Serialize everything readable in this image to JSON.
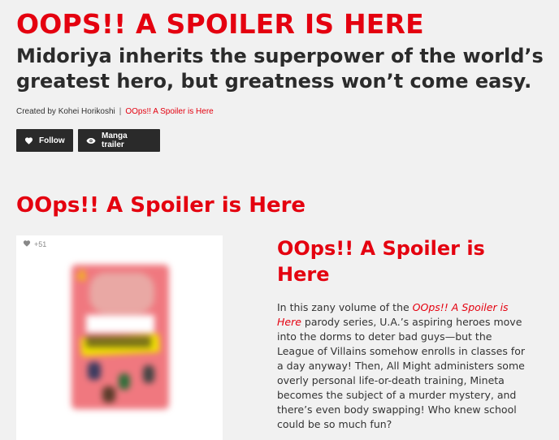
{
  "header": {
    "title": "OOPS!! A SPOILER IS HERE",
    "subtitle": "Midoriya inherits the superpower of the world’s greatest hero, but greatness won’t come easy.",
    "credits": {
      "created_by": "Created by Kohei Horikoshi",
      "separator": "|",
      "link": "OOps!! A Spoiler is Here"
    }
  },
  "actions": {
    "follow_label": "Follow",
    "trailer_label": "Manga trailer"
  },
  "section": {
    "title": "OOps!! A Spoiler is Here"
  },
  "card": {
    "likes": "+51",
    "cover_number": "4",
    "icons": [
      "heart-icon"
    ]
  },
  "info": {
    "title": "OOps!! A Spoiler is Here",
    "desc_before": "In this zany volume of the ",
    "desc_link": "OOps!! A Spoiler is Here",
    "desc_after": " parody series, U.A.’s aspiring heroes move into the dorms to deter bad guys—but the League of Villains somehow enrolls in classes for a day anyway! Then, All Might administers some overly personal life-or-death training, Mineta becomes the subject of a murder mystery, and there’s even body swapping! Who knew school could be so much fun?"
  },
  "colors": {
    "accent": "#e4000f",
    "button_bg": "#2a2a2a",
    "page_bg": "#f1f1f1"
  }
}
